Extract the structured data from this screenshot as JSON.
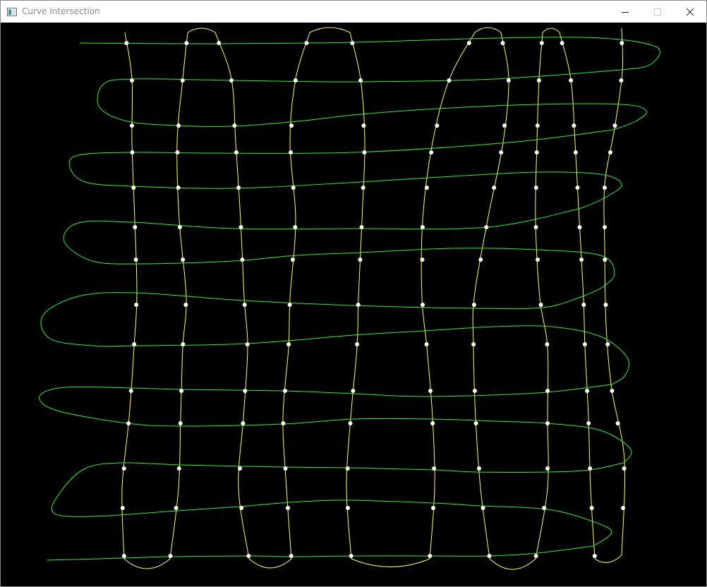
{
  "window": {
    "title": "Curve Intersection",
    "icon": "app-window-icon",
    "controls": [
      "minimize-icon",
      "maximize-icon",
      "close-icon"
    ]
  },
  "colors": {
    "background": "#000000",
    "vertical_curves": "#ffff66",
    "horizontal_curves": "#33ee33",
    "intersection_points": "#ffffff"
  }
}
